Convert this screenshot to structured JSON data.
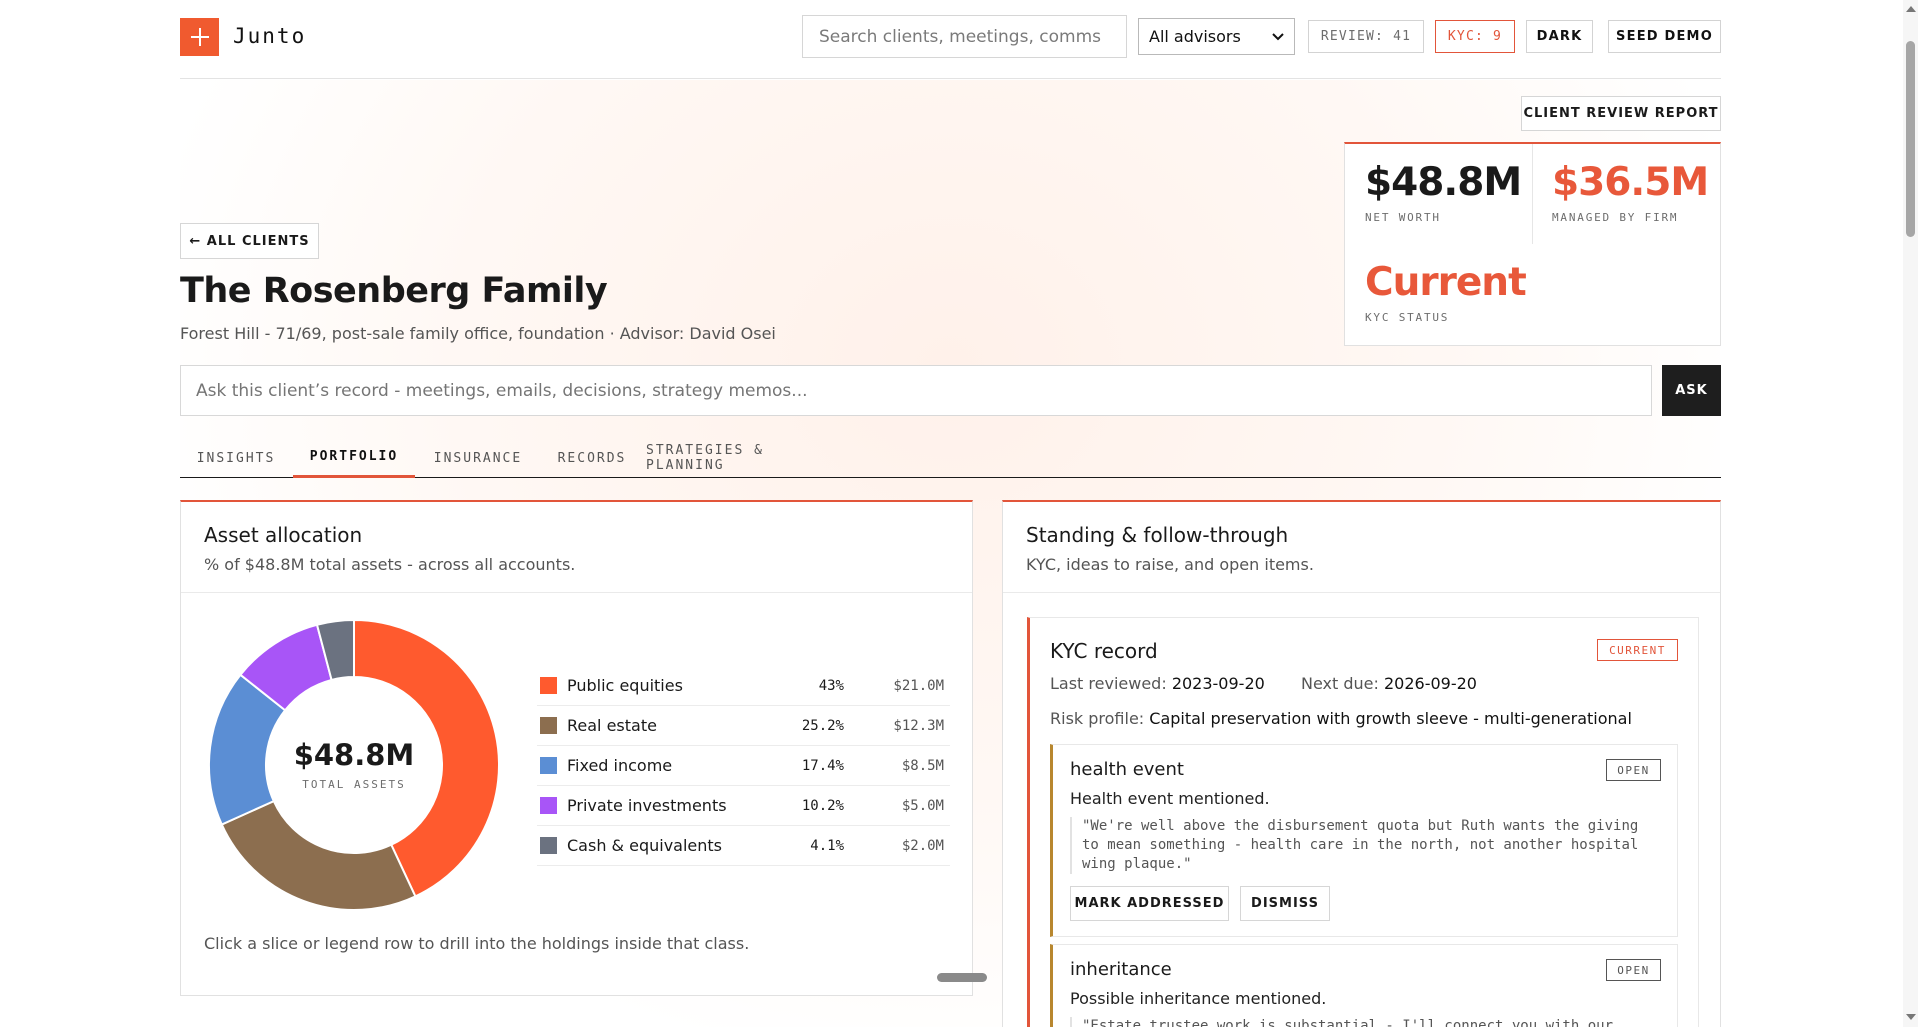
{
  "header": {
    "logo_text": "Junto",
    "search_placeholder": "Search clients, meetings, comms",
    "advisor_filter": "All advisors",
    "review_label": "REVIEW: 41",
    "kyc_label": "KYC: 9",
    "dark_label": "DARK",
    "seed_label": "SEED DEMO"
  },
  "hero": {
    "report_button": "CLIENT REVIEW REPORT",
    "back_button": "← ALL CLIENTS",
    "title": "The Rosenberg Family",
    "subtitle": "Forest Hill - 71/69, post-sale family office, foundation · Advisor: David Osei",
    "stats": [
      {
        "value": "$48.8M",
        "label": "NET WORTH"
      },
      {
        "value": "$36.5M",
        "label": "MANAGED BY FIRM"
      },
      {
        "value": "Current",
        "label": "KYC STATUS"
      }
    ],
    "ask_placeholder": "Ask this client’s record - meetings, emails, decisions, strategy memos...",
    "ask_button": "ASK"
  },
  "tabs": [
    {
      "label": "INSIGHTS"
    },
    {
      "label": "PORTFOLIO",
      "active": true
    },
    {
      "label": "INSURANCE"
    },
    {
      "label": "RECORDS"
    },
    {
      "label": "STRATEGIES & PLANNING"
    }
  ],
  "allocation": {
    "title": "Asset allocation",
    "subtitle": "% of $48.8M total assets - across all accounts.",
    "center_value": "$48.8M",
    "center_label": "TOTAL ASSETS",
    "hint": "Click a slice or legend row to drill into the holdings inside that class.",
    "items": [
      {
        "name": "Public equities",
        "pct": "43%",
        "value": "$21.0M",
        "share": 43,
        "color": "#ff5a2e"
      },
      {
        "name": "Real estate",
        "pct": "25.2%",
        "value": "$12.3M",
        "share": 25.2,
        "color": "#8c6e4f"
      },
      {
        "name": "Fixed income",
        "pct": "17.4%",
        "value": "$8.5M",
        "share": 17.4,
        "color": "#5b8ed4"
      },
      {
        "name": "Private investments",
        "pct": "10.2%",
        "value": "$5.0M",
        "share": 10.2,
        "color": "#a855f7"
      },
      {
        "name": "Cash & equivalents",
        "pct": "4.1%",
        "value": "$2.0M",
        "share": 4.1,
        "color": "#6b7280"
      }
    ]
  },
  "standing": {
    "title": "Standing & follow-through",
    "subtitle": "KYC, ideas to raise, and open items.",
    "kyc": {
      "title": "KYC record",
      "badge": "CURRENT",
      "last_reviewed_label": "Last reviewed:",
      "last_reviewed": "2023-09-20",
      "next_due_label": "Next due:",
      "next_due": "2026-09-20",
      "risk_label": "Risk profile:",
      "risk": "Capital preservation with growth sleeve - multi-generational"
    },
    "issues": [
      {
        "title": "health event",
        "badge": "OPEN",
        "desc": "Health event mentioned.",
        "quote": "\"We're well above the disbursement quota but Ruth wants the giving to mean something - health care in the north, not another hospital wing plaque.\"",
        "mark_button": "MARK ADDRESSED",
        "dismiss_button": "DISMISS"
      },
      {
        "title": "inheritance",
        "badge": "OPEN",
        "desc": "Possible inheritance mentioned.",
        "quote": "\"Estate trustee work is substantial - I'll connect you with our"
      }
    ]
  }
}
